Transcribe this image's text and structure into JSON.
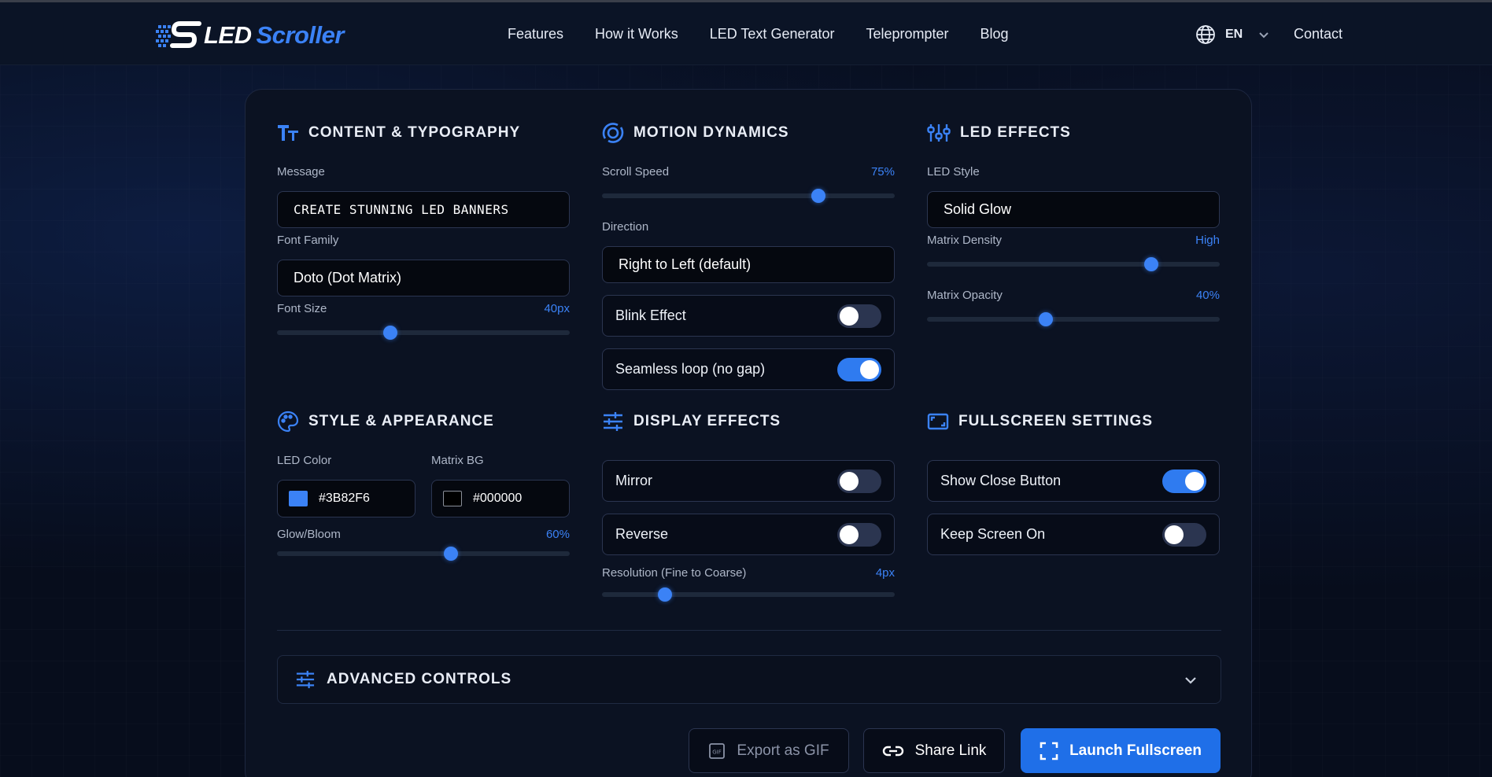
{
  "nav": {
    "logo_led": "LED",
    "logo_scroller": "Scroller",
    "links": [
      "Features",
      "How it Works",
      "LED Text Generator",
      "Teleprompter",
      "Blog"
    ],
    "lang": "EN",
    "contact": "Contact"
  },
  "content": {
    "title": "CONTENT & TYPOGRAPHY",
    "message_label": "Message",
    "message_value": "CREATE STUNNING LED BANNERS",
    "font_family_label": "Font Family",
    "font_family_value": "Doto (Dot Matrix)",
    "font_size_label": "Font Size",
    "font_size_value": "40px",
    "font_size_level": 0.38
  },
  "motion": {
    "title": "MOTION DYNAMICS",
    "scroll_speed_label": "Scroll Speed",
    "scroll_speed_value": "75%",
    "scroll_speed_level": 0.75,
    "direction_label": "Direction",
    "direction_value": "Right to Left (default)",
    "blink_label": "Blink Effect",
    "blink_on": false,
    "seamless_label": "Seamless loop (no gap)",
    "seamless_on": true
  },
  "led": {
    "title": "LED EFFECTS",
    "style_label": "LED Style",
    "style_value": "Solid Glow",
    "density_label": "Matrix Density",
    "density_value": "High",
    "density_level": 0.78,
    "opacity_label": "Matrix Opacity",
    "opacity_value": "40%",
    "opacity_level": 0.4
  },
  "style": {
    "title": "STYLE & APPEARANCE",
    "led_color_label": "LED Color",
    "led_color_value": "#3B82F6",
    "matrix_bg_label": "Matrix BG",
    "matrix_bg_value": "#000000",
    "glow_label": "Glow/Bloom",
    "glow_value": "60%",
    "glow_level": 0.6
  },
  "display": {
    "title": "DISPLAY EFFECTS",
    "mirror_label": "Mirror",
    "mirror_on": false,
    "reverse_label": "Reverse",
    "reverse_on": false,
    "resolution_label": "Resolution (Fine to Coarse)",
    "resolution_value": "4px",
    "resolution_level": 0.2
  },
  "fullscreen": {
    "title": "FULLSCREEN SETTINGS",
    "close_label": "Show Close Button",
    "close_on": true,
    "keep_label": "Keep Screen On",
    "keep_on": false
  },
  "advanced": {
    "title": "ADVANCED CONTROLS"
  },
  "actions": {
    "gif": "Export as GIF",
    "share": "Share Link",
    "launch": "Launch Fullscreen"
  },
  "colors": {
    "accent": "#3B82F6",
    "panel": "#0b1222"
  }
}
